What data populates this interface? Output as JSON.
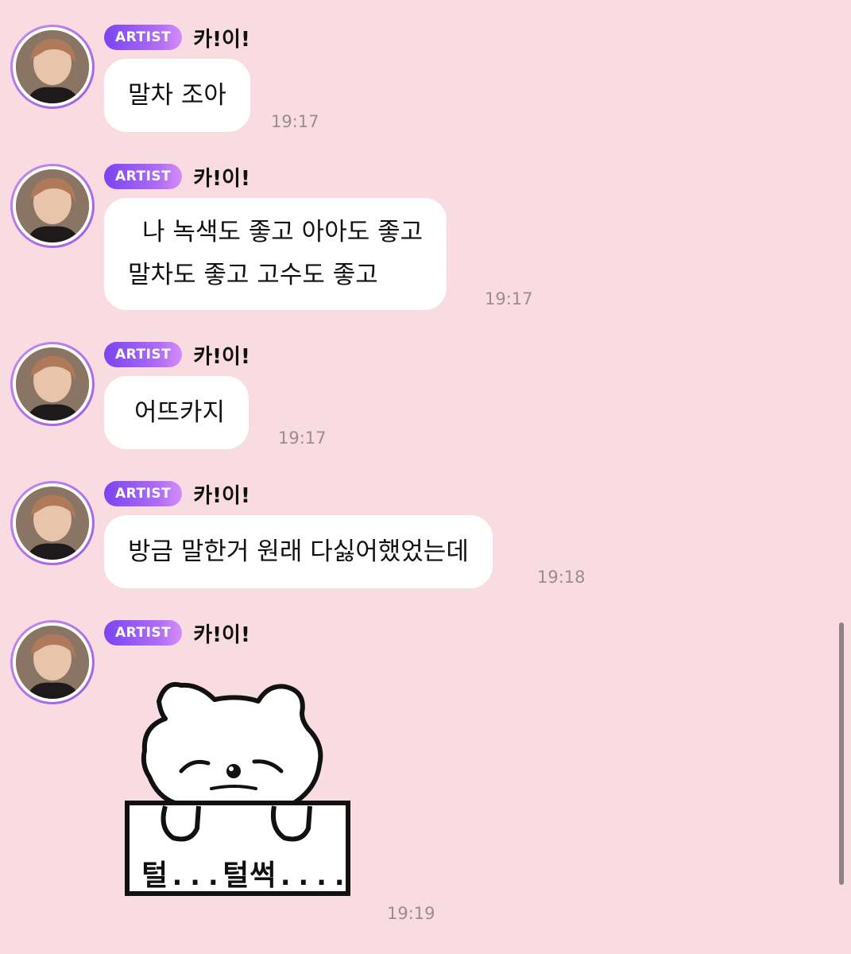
{
  "messages": [
    {
      "badge": "ARTIST",
      "name": "카!이!",
      "lines": [
        "말차 조아"
      ],
      "time": "19:17"
    },
    {
      "badge": "ARTIST",
      "name": "카!이!",
      "lines": [
        "나 녹색도 좋고 아아도 좋고",
        "말차도 좋고 고수도 좋고"
      ],
      "time": "19:17"
    },
    {
      "badge": "ARTIST",
      "name": "카!이!",
      "lines": [
        "어뜨카지"
      ],
      "time": "19:17"
    },
    {
      "badge": "ARTIST",
      "name": "카!이!",
      "lines": [
        "방금 말한거 원래 다싫어했었는데"
      ],
      "time": "19:18"
    },
    {
      "badge": "ARTIST",
      "name": "카!이!",
      "sticker": {
        "icon": "bear-holding-sign-sticker",
        "text": "털...털썩...."
      },
      "time": "19:19"
    }
  ],
  "colors": {
    "background": "#f9dbe2",
    "bubble": "#ffffff",
    "badge_start": "#7a44f0",
    "badge_end": "#d58df8",
    "time": "#9a8d90"
  }
}
